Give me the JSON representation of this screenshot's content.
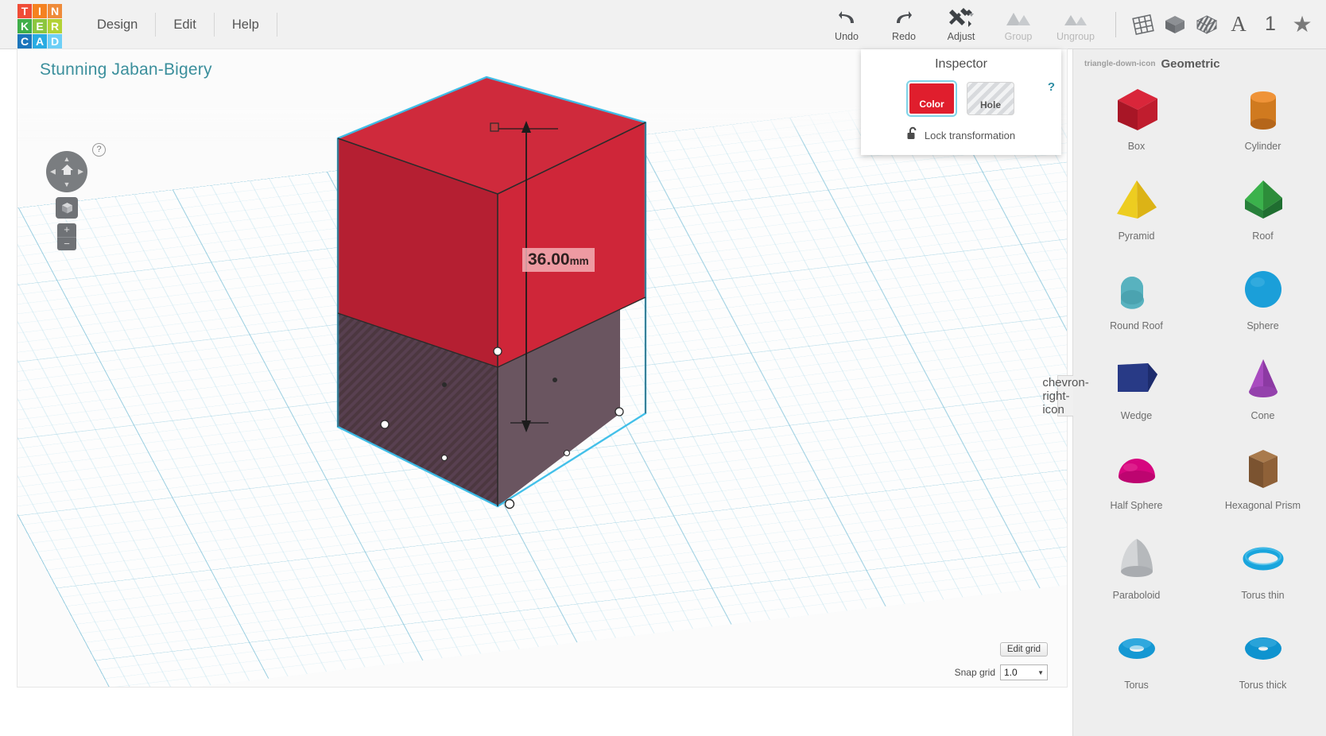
{
  "app": {
    "logo_letters": [
      "T",
      "I",
      "N",
      "K",
      "E",
      "R",
      "C",
      "A",
      "D"
    ],
    "logo_colors": [
      "#f04d37",
      "#f58220",
      "#ef8b3a",
      "#3fae49",
      "#8cc63f",
      "#b2d235",
      "#1b75bb",
      "#29abe2",
      "#6dcff6"
    ]
  },
  "menubar": {
    "items": [
      {
        "label": "Design"
      },
      {
        "label": "Edit"
      },
      {
        "label": "Help"
      }
    ]
  },
  "toolbar": {
    "tools": [
      {
        "label": "Undo",
        "icon": "undo-icon",
        "disabled": false
      },
      {
        "label": "Redo",
        "icon": "redo-icon",
        "disabled": false
      },
      {
        "label": "Adjust",
        "icon": "adjust-icon",
        "disabled": false,
        "has_caret": true
      },
      {
        "label": "Group",
        "icon": "group-icon",
        "disabled": true
      },
      {
        "label": "Ungroup",
        "icon": "ungroup-icon",
        "disabled": true
      }
    ],
    "right_tools": [
      {
        "name": "workplane-icon",
        "label": ""
      },
      {
        "name": "solid-box-icon",
        "label": ""
      },
      {
        "name": "striped-box-icon",
        "label": ""
      },
      {
        "name": "text-tool",
        "label": "A"
      },
      {
        "name": "number-tool",
        "label": "1"
      },
      {
        "name": "favorites-star",
        "label": "★"
      }
    ]
  },
  "canvas": {
    "project_title": "Stunning Jaban-Bigery",
    "dimension_label": {
      "value": "36.00",
      "unit": "mm"
    },
    "help_badge": "?",
    "nav": {
      "home_icon": "home-icon",
      "up": "▲",
      "down": "▼",
      "left": "◀",
      "right": "▶",
      "fit_icon": "fit-view-icon",
      "zoom_in": "+",
      "zoom_out": "−"
    },
    "edit_grid_label": "Edit grid",
    "snap_grid_label": "Snap grid",
    "snap_grid_value": "1.0",
    "snap_caret": "▼",
    "object_color": "#cb2233",
    "object_hole_color": "#4a3440",
    "selection_color": "#39bde8"
  },
  "inspector": {
    "title": "Inspector",
    "color_label": "Color",
    "hole_label": "Hole",
    "help": "?",
    "lock_label": "Lock transformation",
    "lock_icon": "unlocked-padlock-icon",
    "color_value": "#e01e2d"
  },
  "shapes_panel": {
    "category": "Geometric",
    "collapse_icon": "triangle-down-icon",
    "panel_toggle_icon": "chevron-right-icon",
    "shapes": [
      {
        "label": "Box",
        "color": "#c31c2e",
        "art": "cube"
      },
      {
        "label": "Cylinder",
        "color": "#e07a22",
        "art": "cylinder"
      },
      {
        "label": "Pyramid",
        "color": "#edc516",
        "art": "pyramid"
      },
      {
        "label": "Roof",
        "color": "#2f9e42",
        "art": "roof"
      },
      {
        "label": "Round Roof",
        "color": "#5cb9c4",
        "art": "roundroof"
      },
      {
        "label": "Sphere",
        "color": "#1a9fd8",
        "art": "sphere"
      },
      {
        "label": "Wedge",
        "color": "#283a86",
        "art": "wedge"
      },
      {
        "label": "Cone",
        "color": "#9b3fb5",
        "art": "cone"
      },
      {
        "label": "Half Sphere",
        "color": "#d6067f",
        "art": "halfsphere"
      },
      {
        "label": "Hexagonal Prism",
        "color": "#8a5a33",
        "art": "hexprism"
      },
      {
        "label": "Paraboloid",
        "color": "#c9c9c9",
        "art": "paraboloid"
      },
      {
        "label": "Torus thin",
        "color": "#1aa8dd",
        "art": "torusthin"
      },
      {
        "label": "Torus",
        "color": "#159fd6",
        "art": "torus"
      },
      {
        "label": "Torus thick",
        "color": "#0f93cf",
        "art": "torusthick"
      }
    ]
  }
}
